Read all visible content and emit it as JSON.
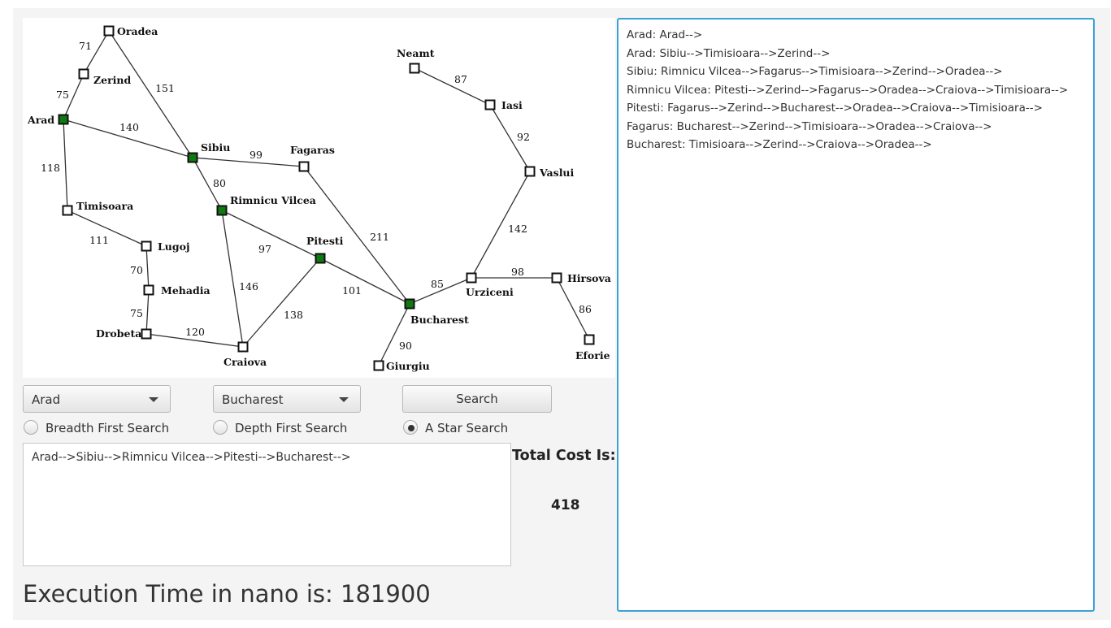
{
  "map": {
    "cities": [
      {
        "id": "oradea",
        "name": "Oradea",
        "visited": false
      },
      {
        "id": "zerind",
        "name": "Zerind",
        "visited": false
      },
      {
        "id": "arad",
        "name": "Arad",
        "visited": true
      },
      {
        "id": "timisoara",
        "name": "Timisoara",
        "visited": false
      },
      {
        "id": "sibiu",
        "name": "Sibiu",
        "visited": true
      },
      {
        "id": "fagaras",
        "name": "Fagaras",
        "visited": false
      },
      {
        "id": "rimnicu",
        "name": "Rimnicu Vilcea",
        "visited": true
      },
      {
        "id": "lugoj",
        "name": "Lugoj",
        "visited": false
      },
      {
        "id": "mehadia",
        "name": "Mehadia",
        "visited": false
      },
      {
        "id": "drobeta",
        "name": "Drobeta",
        "visited": false
      },
      {
        "id": "craiova",
        "name": "Craiova",
        "visited": false
      },
      {
        "id": "pitesti",
        "name": "Pitesti",
        "visited": true
      },
      {
        "id": "bucharest",
        "name": "Bucharest",
        "visited": true
      },
      {
        "id": "giurgiu",
        "name": "Giurgiu",
        "visited": false
      },
      {
        "id": "urziceni",
        "name": "Urziceni",
        "visited": false
      },
      {
        "id": "hirsova",
        "name": "Hirsova",
        "visited": false
      },
      {
        "id": "eforie",
        "name": "Eforie",
        "visited": false
      },
      {
        "id": "vaslui",
        "name": "Vaslui",
        "visited": false
      },
      {
        "id": "iasi",
        "name": "Iasi",
        "visited": false
      },
      {
        "id": "neamt",
        "name": "Neamt",
        "visited": false
      }
    ],
    "roads": [
      {
        "from": "oradea",
        "to": "zerind",
        "distance": "71"
      },
      {
        "from": "zerind",
        "to": "arad",
        "distance": "75"
      },
      {
        "from": "oradea",
        "to": "sibiu",
        "distance": "151"
      },
      {
        "from": "arad",
        "to": "sibiu",
        "distance": "140"
      },
      {
        "from": "arad",
        "to": "timisoara",
        "distance": "118"
      },
      {
        "from": "sibiu",
        "to": "fagaras",
        "distance": "99"
      },
      {
        "from": "sibiu",
        "to": "rimnicu",
        "distance": "80"
      },
      {
        "from": "timisoara",
        "to": "lugoj",
        "distance": "111"
      },
      {
        "from": "lugoj",
        "to": "mehadia",
        "distance": "70"
      },
      {
        "from": "mehadia",
        "to": "drobeta",
        "distance": "75"
      },
      {
        "from": "drobeta",
        "to": "craiova",
        "distance": "120"
      },
      {
        "from": "rimnicu",
        "to": "craiova",
        "distance": "146"
      },
      {
        "from": "rimnicu",
        "to": "pitesti",
        "distance": "97"
      },
      {
        "from": "craiova",
        "to": "pitesti",
        "distance": "138"
      },
      {
        "from": "pitesti",
        "to": "bucharest",
        "distance": "101"
      },
      {
        "from": "fagaras",
        "to": "bucharest",
        "distance": "211"
      },
      {
        "from": "bucharest",
        "to": "giurgiu",
        "distance": "90"
      },
      {
        "from": "bucharest",
        "to": "urziceni",
        "distance": "85"
      },
      {
        "from": "urziceni",
        "to": "hirsova",
        "distance": "98"
      },
      {
        "from": "hirsova",
        "to": "eforie",
        "distance": "86"
      },
      {
        "from": "urziceni",
        "to": "vaslui",
        "distance": "142"
      },
      {
        "from": "vaslui",
        "to": "iasi",
        "distance": "92"
      },
      {
        "from": "iasi",
        "to": "neamt",
        "distance": "87"
      }
    ],
    "colors": {
      "visited": "#0f7a0f",
      "unvisited": "#ffffff",
      "road": "#333333"
    }
  },
  "controls": {
    "source_value": "Arad",
    "destination_value": "Bucharest",
    "search_label": "Search",
    "algorithms": [
      {
        "label": "Breadth First Search",
        "selected": false
      },
      {
        "label": "Depth First Search",
        "selected": false
      },
      {
        "label": "A Star Search",
        "selected": true
      }
    ]
  },
  "result": {
    "path_text": "Arad-->Sibiu-->Rimnicu Vilcea-->Pitesti-->Bucharest-->",
    "total_cost_label": "Total Cost Is:",
    "total_cost_value": "418",
    "execution_time": "Execution Time in nano is: 181900"
  },
  "log": {
    "lines": [
      "Arad: Arad-->",
      "Arad: Sibiu-->Timisioara-->Zerind-->",
      "Sibiu: Rimnicu Vilcea-->Fagarus-->Timisioara-->Zerind-->Oradea-->",
      "Rimnicu Vilcea: Pitesti-->Zerind-->Fagarus-->Oradea-->Craiova-->Timisioara-->",
      "Pitesti: Fagarus-->Zerind-->Bucharest-->Oradea-->Craiova-->Timisioara-->",
      "Fagarus: Bucharest-->Zerind-->Timisioara-->Oradea-->Craiova-->",
      "Bucharest: Timisioara-->Zerind-->Craiova-->Oradea-->"
    ],
    "accent_color": "#3ba2d6"
  }
}
